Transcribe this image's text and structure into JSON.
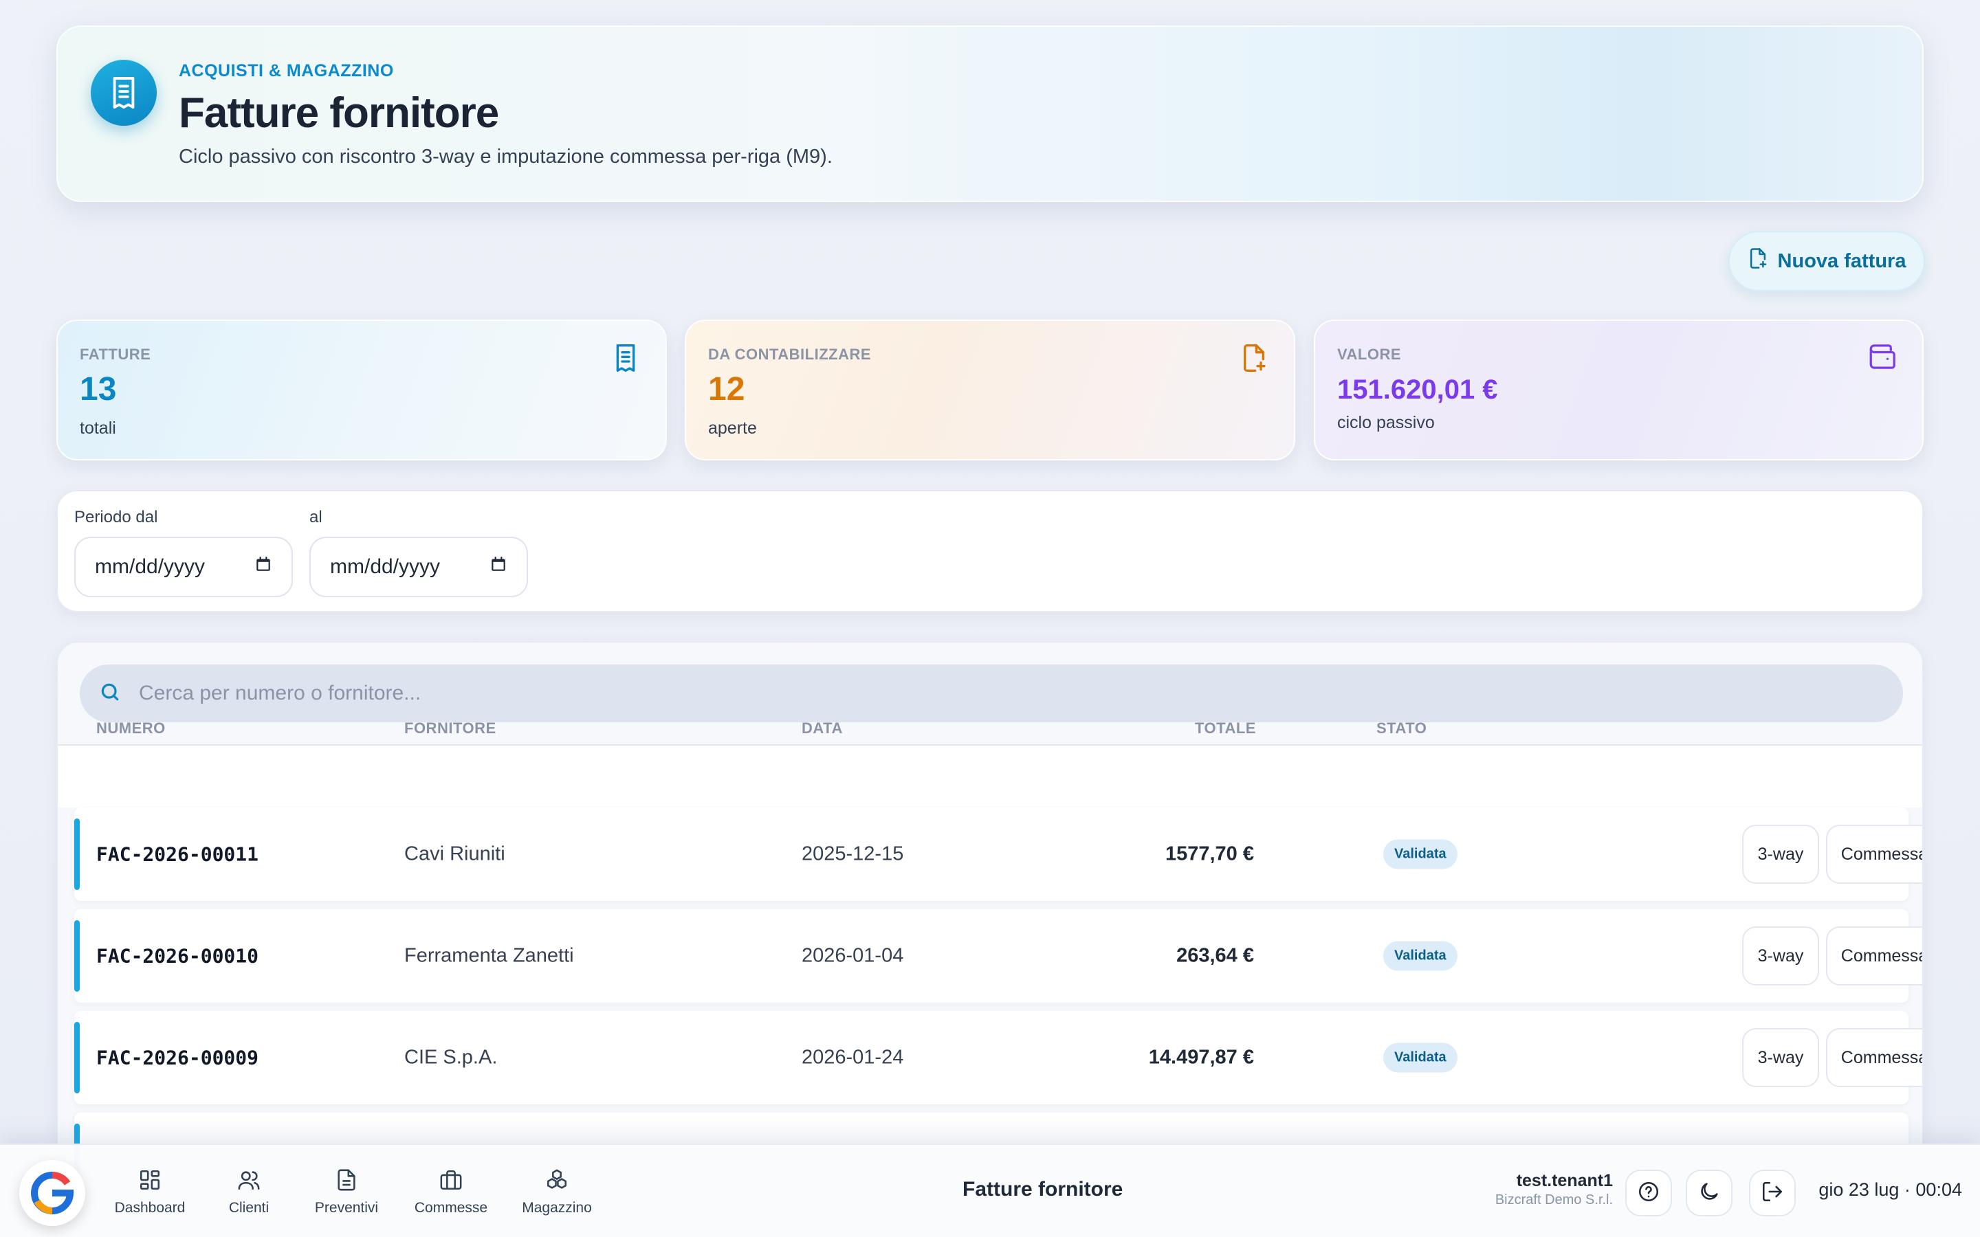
{
  "header": {
    "eyebrow": "ACQUISTI & MAGAZZINO",
    "title": "Fatture fornitore",
    "subtitle": "Ciclo passivo con riscontro 3-way e imputazione commessa per-riga (M9).",
    "icon": "receipt-icon"
  },
  "actions": {
    "new_invoice_label": "Nuova fattura",
    "new_invoice_icon": "file-plus-icon"
  },
  "kpis": [
    {
      "label": "FATTURE",
      "value": "13",
      "note": "totali",
      "color": "#0b86c4",
      "icon": "receipt-icon"
    },
    {
      "label": "DA CONTABILIZZARE",
      "value": "12",
      "note": "aperte",
      "color": "#d97706",
      "icon": "file-plus-icon"
    },
    {
      "label": "VALORE",
      "value": "151.620,01 €",
      "note": "ciclo passivo",
      "color": "#7c3aed",
      "icon": "wallet-icon"
    }
  ],
  "filters": {
    "from_label": "Periodo dal",
    "from_value": "mm/dd/yyyy",
    "to_label": "al",
    "to_value": "mm/dd/yyyy"
  },
  "search": {
    "placeholder": "Cerca per numero o fornitore..."
  },
  "table": {
    "columns": [
      "NUMERO",
      "FORNITORE",
      "DATA",
      "TOTALE",
      "STATO"
    ],
    "rows": [
      {
        "numero": "FAC-2026-00011",
        "fornitore": "Cavi Riuniti",
        "data": "2025-12-15",
        "totale": "1577,70 €",
        "stato": "Validata",
        "btn_3way": "3-way",
        "btn_commessa": "Commessa"
      },
      {
        "numero": "FAC-2026-00010",
        "fornitore": "Ferramenta Zanetti",
        "data": "2026-01-04",
        "totale": "263,64 €",
        "stato": "Validata",
        "btn_3way": "3-way",
        "btn_commessa": "Commessa"
      },
      {
        "numero": "FAC-2026-00009",
        "fornitore": "CIE S.p.A.",
        "data": "2026-01-24",
        "totale": "14.497,87 €",
        "stato": "Validata",
        "btn_3way": "3-way",
        "btn_commessa": "Commessa"
      }
    ]
  },
  "nav": {
    "items": [
      {
        "label": "Dashboard",
        "icon": "grid-icon"
      },
      {
        "label": "Clienti",
        "icon": "users-icon"
      },
      {
        "label": "Preventivi",
        "icon": "document-icon"
      },
      {
        "label": "Commesse",
        "icon": "briefcase-icon"
      },
      {
        "label": "Magazzino",
        "icon": "boxes-icon"
      }
    ],
    "page_title": "Fatture fornitore",
    "user_name": "test.tenant1",
    "org_name": "Bizcraft Demo S.r.l.",
    "datetime": "gio 23 lug · 00:04"
  },
  "colors": {
    "accent": "#0b86c4",
    "row_bar": "#1aa7e0"
  }
}
